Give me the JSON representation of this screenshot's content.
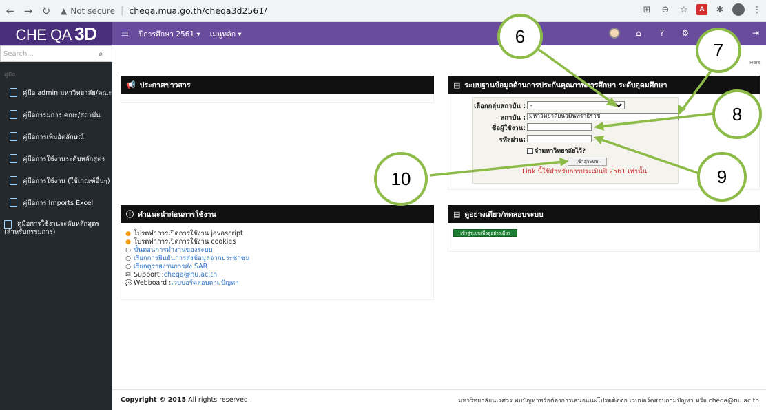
{
  "browser": {
    "not_secure": "Not secure",
    "url": "cheqa.mua.go.th/cheqa3d2561/"
  },
  "header": {
    "logo_text": "CHE QA",
    "logo_3d": "3D",
    "menu_year": "ปีการศึกษา 2561 ▾",
    "menu_main": "เมนูหลัก ▾"
  },
  "sidebar": {
    "search_placeholder": "Search...",
    "section": "คู่มือ",
    "items": [
      {
        "label": "คู่มือ admin มหาวิทยาลัย/คณะ"
      },
      {
        "label": "คู่มือกรรมการ คณะ/สถาบัน"
      },
      {
        "label": "คู่มือการเพิ่มอัตลักษณ์"
      },
      {
        "label": "คู่มือการใช้งานระดับหลักสูตร"
      },
      {
        "label": "คู่มือการใช้งาน (ใช้เกณฑ์อื่นๆ)"
      },
      {
        "label": "คู่มือการ Imports Excel"
      },
      {
        "label": "คู่มือการใช้งานระดับหลักสูตร",
        "label2": "(สำหรับกรรมการ)"
      }
    ]
  },
  "right_edge_text": "Here",
  "news_panel": {
    "title": "ประกาศข่าวสาร"
  },
  "login_panel": {
    "title": "ระบบฐานข้อมูลด้านการประกันคุณภาพการศึกษา ระดับอุดมศึกษา",
    "group_label": "เลือกกลุ่มสถาบัน :",
    "group_value": "-",
    "institution_label": "สถาบัน :",
    "institution_value": "มหาวิทยาลัยนวมินทราธิราช",
    "username_label": "ชื่อผู้ใช้งาน:",
    "username_value": "",
    "password_label": "รหัสผ่าน:",
    "password_value": "",
    "remember_label": "จำมหาวิทยาลัยไว้?",
    "login_button": "เข้าสู่ระบบ",
    "note": "Link นี้ใช้สำหรับการประเมินปี 2561 เท่านั้น"
  },
  "guide_panel": {
    "title": "คำแนะนำก่อนการใช้งาน",
    "items": [
      {
        "text": "โปรดทำการเปิดการใช้งาน javascript"
      },
      {
        "text": "โปรดทำการเปิดการใช้งาน cookies"
      },
      {
        "text": "ขั้นตอนการทำงานของระบบ"
      },
      {
        "text": "เรียกการยืนยันการส่งข้อมูลจากประชาชน"
      },
      {
        "text": "เรียกดูรายงานการส่ง SAR"
      },
      {
        "prefix": "Support : ",
        "text": "cheqa@nu.ac.th"
      },
      {
        "prefix": "Webboard : ",
        "text": "เวบบอร์ดสอบถามปัญหา"
      }
    ]
  },
  "demo_panel": {
    "title": "ดูอย่างเดียว/ทดสอบระบบ",
    "button": "เข้าสู่ระบบเพื่อดูอย่างเดียว"
  },
  "footer": {
    "copyright_bold": "Copyright © 2015",
    "copyright_rest": " All rights reserved.",
    "right": "มหาวิทยาลัยนเรศวร พบปัญหาหรือต้องการเสนอแนะโปรดติดต่อ เวบบอร์ดสอบถามปัญหา หรือ cheqa@nu.ac.th"
  },
  "callouts": [
    "6",
    "7",
    "8",
    "9",
    "10"
  ],
  "colors": {
    "header_bg": "#6a4c9c",
    "logo_bg": "#4a2f7c",
    "sidebar_bg": "#24292e",
    "panel_header_bg": "#111111",
    "callout_border": "#8dbb48",
    "demo_button": "#1e7e34",
    "note_red": "#c62828"
  }
}
